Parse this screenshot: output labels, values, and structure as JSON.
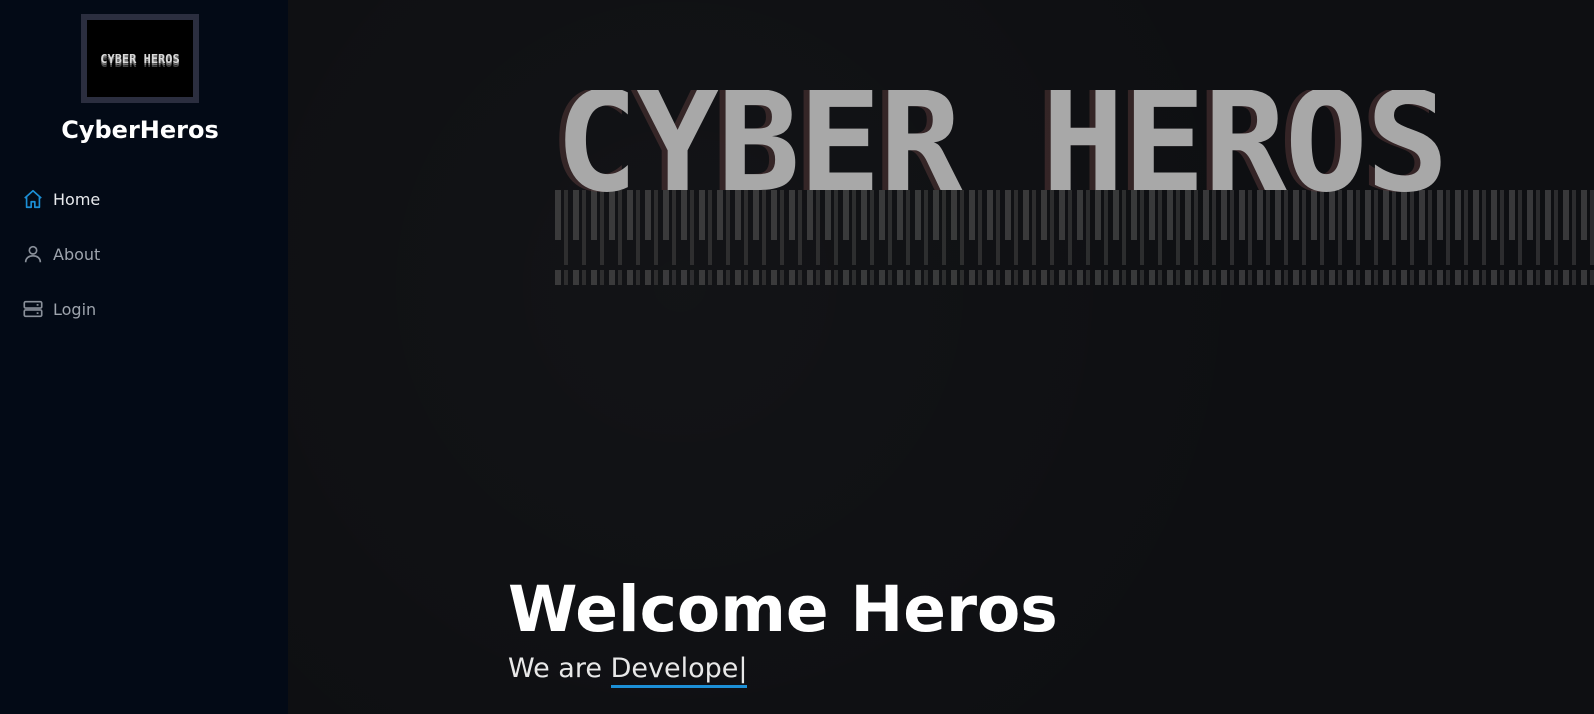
{
  "sidebar": {
    "logo_text": "CYBER HEROS",
    "brand": "CyberHeros",
    "items": [
      {
        "label": "Home",
        "icon": "home-icon",
        "active": true
      },
      {
        "label": "About",
        "icon": "user-icon",
        "active": false
      },
      {
        "label": "Login",
        "icon": "server-icon",
        "active": false
      }
    ]
  },
  "hero": {
    "banner_text": "CYBER HEROS",
    "title": "Welcome Heros",
    "subtitle_prefix": "We are",
    "typed_text": "Develope|"
  },
  "colors": {
    "accent": "#1c8fd6",
    "sidebar_bg": "#030a16",
    "main_bg": "#0e0f12"
  }
}
